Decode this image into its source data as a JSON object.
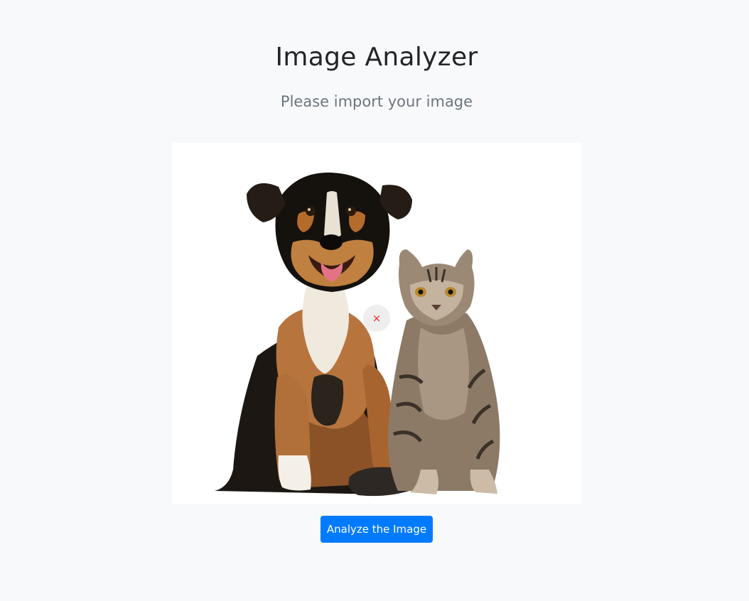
{
  "header": {
    "title": "Image Analyzer",
    "subtitle": "Please import your image"
  },
  "preview": {
    "image_description_icon": "dog-and-cat-photo",
    "remove_glyph": "×",
    "remove_icon": "close-icon"
  },
  "actions": {
    "analyze_label": "Analyze the Image"
  },
  "colors": {
    "background": "#f8f9fa",
    "primary": "#007bff",
    "title": "#212529",
    "subtitle": "#6c757d",
    "remove": "#e8262b"
  }
}
